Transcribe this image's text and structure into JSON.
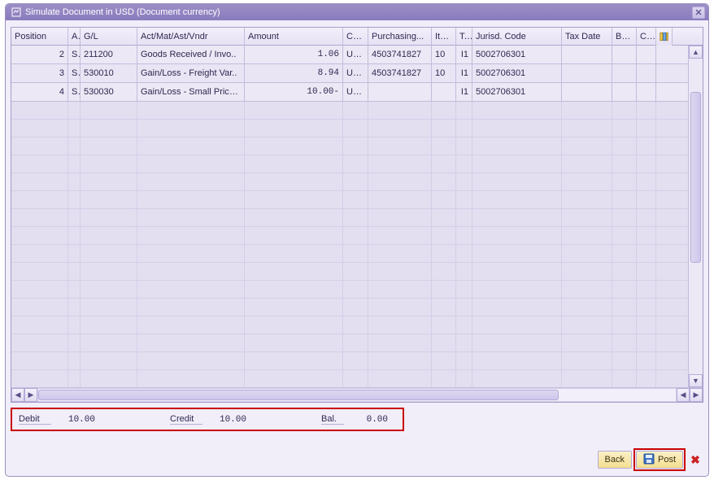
{
  "window": {
    "title": "Simulate Document in USD (Document currency)"
  },
  "columns": {
    "position": "Position",
    "a": "A",
    "gl": "G/L",
    "act": "Act/Mat/Ast/Vndr",
    "amount": "Amount",
    "cu": "Cu...",
    "purch": "Purchasing...",
    "item": "Item",
    "t": "T..",
    "jurisd": "Jurisd. Code",
    "taxdate": "Tax Date",
    "bu": "Bu...",
    "cos": "Co:"
  },
  "rows": [
    {
      "position": "2",
      "a": "S",
      "gl": "211200",
      "act": "Goods Received / Invo..",
      "amount": "1.06",
      "cu": "USD",
      "purch": "4503741827",
      "item": "10",
      "t": "I1",
      "jurisd": "5002706301",
      "taxdate": "",
      "bu": "",
      "cos": ""
    },
    {
      "position": "3",
      "a": "S",
      "gl": "530010",
      "act": "Gain/Loss - Freight Var..",
      "amount": "8.94",
      "cu": "USD",
      "purch": "4503741827",
      "item": "10",
      "t": "I1",
      "jurisd": "5002706301",
      "taxdate": "",
      "bu": "",
      "cos": ""
    },
    {
      "position": "4",
      "a": "S",
      "gl": "530030",
      "act": "Gain/Loss - Small Price ..",
      "amount": "10.00-",
      "cu": "USD",
      "purch": "",
      "item": "",
      "t": "I1",
      "jurisd": "5002706301",
      "taxdate": "",
      "bu": "",
      "cos": ""
    }
  ],
  "totals": {
    "debit_label": "Debit",
    "debit_value": "10.00",
    "credit_label": "Credit",
    "credit_value": "10.00",
    "bal_label": "Bal.",
    "bal_value": "0.00"
  },
  "buttons": {
    "back": "Back",
    "post": "Post"
  }
}
